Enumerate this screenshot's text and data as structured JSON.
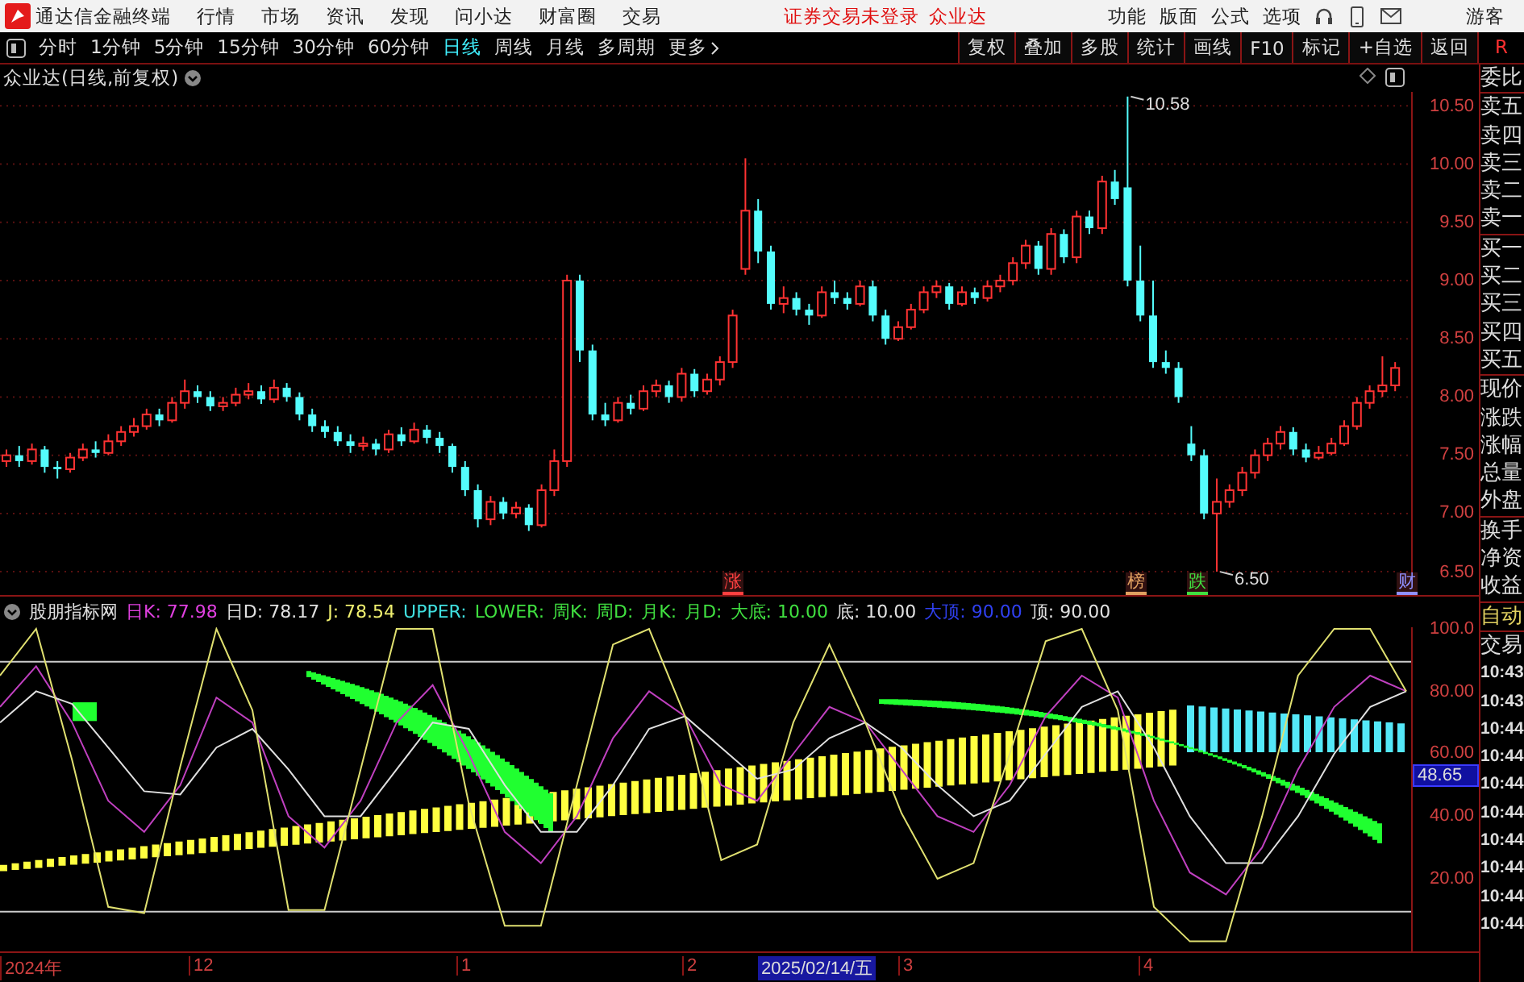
{
  "topbar": {
    "app_title": "通达信金融终端",
    "menu": [
      "行情",
      "市场",
      "资讯",
      "发现",
      "问小达",
      "财富圈",
      "交易"
    ],
    "notice": "证券交易未登录",
    "stock_name": "众业达",
    "right_menu": [
      "功能",
      "版面",
      "公式",
      "选项"
    ],
    "user": "游客"
  },
  "toolbar": {
    "periods": [
      {
        "label": "分时",
        "selected": false
      },
      {
        "label": "1分钟",
        "selected": false
      },
      {
        "label": "5分钟",
        "selected": false
      },
      {
        "label": "15分钟",
        "selected": false
      },
      {
        "label": "30分钟",
        "selected": false
      },
      {
        "label": "60分钟",
        "selected": false
      },
      {
        "label": "日线",
        "selected": true
      },
      {
        "label": "周线",
        "selected": false
      },
      {
        "label": "月线",
        "selected": false
      },
      {
        "label": "多周期",
        "selected": false
      },
      {
        "label": "更多",
        "selected": false
      }
    ],
    "actions": [
      "复权",
      "叠加",
      "多股",
      "统计",
      "画线",
      "F10",
      "标记",
      "+自选",
      "返回"
    ],
    "badge": "R"
  },
  "price_pane": {
    "title": "众业达(日线,前复权)",
    "chart_data": {
      "type": "candlestick",
      "grid": true,
      "ylim": [
        6.3,
        10.62
      ],
      "yticks": [
        {
          "value": 10.5,
          "label": "10.50"
        },
        {
          "value": 10,
          "label": "10.00"
        },
        {
          "value": 9.5,
          "label": "9.50"
        },
        {
          "value": 9,
          "label": "9.00"
        },
        {
          "value": 8.5,
          "label": "8.50"
        },
        {
          "value": 8,
          "label": "8.00"
        },
        {
          "value": 7.5,
          "label": "7.50"
        },
        {
          "value": 7,
          "label": "7.00"
        },
        {
          "value": 6.5,
          "label": "6.50"
        }
      ],
      "ohlc": [
        [
          7.45,
          7.55,
          7.4,
          7.5
        ],
        [
          7.5,
          7.58,
          7.4,
          7.45
        ],
        [
          7.45,
          7.6,
          7.42,
          7.55
        ],
        [
          7.55,
          7.58,
          7.35,
          7.4
        ],
        [
          7.4,
          7.45,
          7.3,
          7.38
        ],
        [
          7.38,
          7.52,
          7.35,
          7.48
        ],
        [
          7.48,
          7.6,
          7.45,
          7.55
        ],
        [
          7.55,
          7.62,
          7.48,
          7.52
        ],
        [
          7.52,
          7.68,
          7.5,
          7.62
        ],
        [
          7.62,
          7.75,
          7.58,
          7.7
        ],
        [
          7.7,
          7.82,
          7.66,
          7.75
        ],
        [
          7.75,
          7.9,
          7.72,
          7.85
        ],
        [
          7.85,
          7.9,
          7.75,
          7.8
        ],
        [
          7.8,
          8.0,
          7.78,
          7.95
        ],
        [
          7.95,
          8.15,
          7.9,
          8.05
        ],
        [
          8.05,
          8.1,
          7.95,
          8.0
        ],
        [
          8.0,
          8.05,
          7.88,
          7.92
        ],
        [
          7.92,
          8.0,
          7.88,
          7.95
        ],
        [
          7.95,
          8.08,
          7.92,
          8.02
        ],
        [
          8.02,
          8.12,
          7.98,
          8.05
        ],
        [
          8.05,
          8.1,
          7.94,
          7.98
        ],
        [
          7.98,
          8.15,
          7.95,
          8.08
        ],
        [
          8.08,
          8.12,
          7.96,
          8.0
        ],
        [
          8.0,
          8.04,
          7.8,
          7.85
        ],
        [
          7.85,
          7.9,
          7.7,
          7.75
        ],
        [
          7.75,
          7.8,
          7.65,
          7.7
        ],
        [
          7.7,
          7.75,
          7.58,
          7.62
        ],
        [
          7.62,
          7.68,
          7.52,
          7.58
        ],
        [
          7.58,
          7.66,
          7.54,
          7.6
        ],
        [
          7.6,
          7.64,
          7.5,
          7.55
        ],
        [
          7.55,
          7.72,
          7.52,
          7.68
        ],
        [
          7.68,
          7.74,
          7.58,
          7.62
        ],
        [
          7.62,
          7.78,
          7.6,
          7.72
        ],
        [
          7.72,
          7.76,
          7.6,
          7.65
        ],
        [
          7.65,
          7.7,
          7.52,
          7.58
        ],
        [
          7.58,
          7.6,
          7.35,
          7.4
        ],
        [
          7.4,
          7.45,
          7.15,
          7.2
        ],
        [
          7.2,
          7.25,
          6.88,
          6.95
        ],
        [
          6.95,
          7.15,
          6.9,
          7.1
        ],
        [
          7.1,
          7.14,
          6.95,
          7.0
        ],
        [
          7.0,
          7.1,
          6.96,
          7.05
        ],
        [
          7.05,
          7.08,
          6.85,
          6.9
        ],
        [
          6.9,
          7.25,
          6.88,
          7.2
        ],
        [
          7.2,
          7.55,
          7.15,
          7.45
        ],
        [
          7.45,
          9.05,
          7.4,
          9.0
        ],
        [
          9.0,
          9.05,
          8.3,
          8.4
        ],
        [
          8.4,
          8.45,
          7.8,
          7.85
        ],
        [
          7.85,
          7.95,
          7.75,
          7.8
        ],
        [
          7.8,
          8.0,
          7.78,
          7.95
        ],
        [
          7.95,
          8.02,
          7.85,
          7.9
        ],
        [
          7.9,
          8.1,
          7.88,
          8.05
        ],
        [
          8.05,
          8.15,
          8.0,
          8.1
        ],
        [
          8.1,
          8.14,
          7.95,
          8.0
        ],
        [
          8.0,
          8.25,
          7.96,
          8.2
        ],
        [
          8.2,
          8.24,
          8.0,
          8.05
        ],
        [
          8.05,
          8.2,
          8.02,
          8.15
        ],
        [
          8.15,
          8.35,
          8.1,
          8.3
        ],
        [
          8.3,
          8.75,
          8.25,
          8.7
        ],
        [
          9.1,
          10.05,
          9.05,
          9.6
        ],
        [
          9.6,
          9.7,
          9.15,
          9.25
        ],
        [
          9.25,
          9.3,
          8.75,
          8.8
        ],
        [
          8.8,
          8.95,
          8.72,
          8.85
        ],
        [
          8.85,
          8.9,
          8.7,
          8.75
        ],
        [
          8.75,
          8.8,
          8.62,
          8.7
        ],
        [
          8.7,
          8.95,
          8.68,
          8.9
        ],
        [
          8.9,
          9.0,
          8.8,
          8.85
        ],
        [
          8.85,
          8.9,
          8.75,
          8.8
        ],
        [
          8.8,
          9.0,
          8.78,
          8.95
        ],
        [
          8.95,
          9.0,
          8.65,
          8.7
        ],
        [
          8.7,
          8.75,
          8.45,
          8.5
        ],
        [
          8.5,
          8.65,
          8.48,
          8.6
        ],
        [
          8.6,
          8.8,
          8.58,
          8.75
        ],
        [
          8.75,
          8.95,
          8.72,
          8.9
        ],
        [
          8.9,
          9.0,
          8.85,
          8.95
        ],
        [
          8.95,
          8.98,
          8.75,
          8.8
        ],
        [
          8.8,
          8.95,
          8.78,
          8.9
        ],
        [
          8.9,
          8.94,
          8.8,
          8.85
        ],
        [
          8.85,
          9.0,
          8.82,
          8.95
        ],
        [
          8.95,
          9.05,
          8.9,
          9.0
        ],
        [
          9.0,
          9.2,
          8.96,
          9.15
        ],
        [
          9.15,
          9.35,
          9.1,
          9.3
        ],
        [
          9.3,
          9.34,
          9.05,
          9.1
        ],
        [
          9.1,
          9.45,
          9.05,
          9.4
        ],
        [
          9.4,
          9.44,
          9.15,
          9.2
        ],
        [
          9.2,
          9.6,
          9.15,
          9.55
        ],
        [
          9.55,
          9.6,
          9.4,
          9.45
        ],
        [
          9.45,
          9.9,
          9.4,
          9.85
        ],
        [
          9.85,
          9.95,
          9.65,
          9.7
        ],
        [
          9.8,
          10.58,
          8.95,
          9.0
        ],
        [
          9.0,
          9.3,
          8.65,
          8.7
        ],
        [
          8.7,
          9.0,
          8.25,
          8.3
        ],
        [
          8.3,
          8.4,
          8.2,
          8.25
        ],
        [
          8.25,
          8.3,
          7.95,
          8.0
        ],
        [
          7.6,
          7.75,
          7.45,
          7.5
        ],
        [
          7.5,
          7.55,
          6.95,
          7.0
        ],
        [
          7.0,
          7.3,
          6.5,
          7.1
        ],
        [
          7.1,
          7.25,
          7.05,
          7.2
        ],
        [
          7.2,
          7.4,
          7.15,
          7.35
        ],
        [
          7.35,
          7.55,
          7.3,
          7.5
        ],
        [
          7.5,
          7.65,
          7.45,
          7.6
        ],
        [
          7.6,
          7.75,
          7.55,
          7.7
        ],
        [
          7.7,
          7.74,
          7.5,
          7.55
        ],
        [
          7.55,
          7.6,
          7.44,
          7.48
        ],
        [
          7.48,
          7.58,
          7.46,
          7.52
        ],
        [
          7.52,
          7.65,
          7.5,
          7.6
        ],
        [
          7.6,
          7.8,
          7.58,
          7.75
        ],
        [
          7.75,
          8.0,
          7.72,
          7.95
        ],
        [
          7.95,
          8.1,
          7.9,
          8.05
        ],
        [
          8.05,
          8.35,
          8.0,
          8.1
        ],
        [
          8.1,
          8.3,
          8.05,
          8.25
        ]
      ]
    },
    "annotations": [
      {
        "kind": "high",
        "text": "10.58"
      },
      {
        "kind": "low",
        "text": "6.50"
      }
    ],
    "markers": [
      {
        "text": "涨",
        "color": "#ff4040"
      },
      {
        "text": "榜",
        "color": "#e0a060"
      },
      {
        "text": "跌",
        "color": "#40e040"
      },
      {
        "text": "财",
        "color": "#9090ff"
      }
    ]
  },
  "indicator_pane": {
    "legend": [
      {
        "text": "股朋指标网",
        "color": "#e0e0e0"
      },
      {
        "text": "日K: 77.98",
        "color": "#e040e0"
      },
      {
        "text": "日D: 78.17",
        "color": "#e0e0e0"
      },
      {
        "text": "J: 78.54",
        "color": "#f0f070"
      },
      {
        "text": "UPPER:",
        "color": "#40e0e0"
      },
      {
        "text": "LOWER:",
        "color": "#40e040"
      },
      {
        "text": "周K:",
        "color": "#40e040"
      },
      {
        "text": "周D:",
        "color": "#40e040"
      },
      {
        "text": "月K:",
        "color": "#40e040"
      },
      {
        "text": "月D:",
        "color": "#40e040"
      },
      {
        "text": "大底: 10.00",
        "color": "#40e040"
      },
      {
        "text": "底: 10.00",
        "color": "#e0e0e0"
      },
      {
        "text": "大顶: 90.00",
        "color": "#3040f0"
      },
      {
        "text": "顶: 90.00",
        "color": "#e0e0e0"
      }
    ],
    "value_badge": "48.65",
    "chart_data": {
      "type": "line",
      "ylim": [
        -2.7,
        100.5
      ],
      "yticks": [
        {
          "value": 100,
          "label": "100.0"
        },
        {
          "value": 80,
          "label": "80.00"
        },
        {
          "value": 60,
          "label": "60.00"
        },
        {
          "value": 40,
          "label": "40.00"
        },
        {
          "value": 20,
          "label": "20.00"
        }
      ],
      "series": [
        {
          "color": "#c040c0",
          "values": [
            75,
            88,
            70,
            45,
            35,
            50,
            78,
            70,
            40,
            30,
            45,
            70,
            82,
            60,
            35,
            25,
            40,
            65,
            80,
            72,
            50,
            45,
            60,
            75,
            70,
            55,
            40,
            35,
            50,
            72,
            85,
            78,
            45,
            22,
            15,
            30,
            55,
            75,
            85,
            80
          ]
        },
        {
          "color": "#e0e0e0",
          "values": [
            70,
            80,
            76,
            62,
            48,
            47,
            62,
            68,
            55,
            40,
            40,
            55,
            70,
            68,
            50,
            35,
            35,
            50,
            68,
            72,
            62,
            52,
            55,
            65,
            70,
            62,
            50,
            40,
            45,
            60,
            75,
            80,
            62,
            40,
            25,
            25,
            40,
            60,
            75,
            80
          ]
        },
        {
          "color": "#e0e070",
          "values": [
            85,
            100,
            58,
            11,
            9,
            56,
            100,
            74,
            10,
            10,
            55,
            100,
            100,
            44,
            5,
            5,
            50,
            95,
            100,
            72,
            26,
            31,
            70,
            95,
            70,
            41,
            20,
            25,
            60,
            96,
            100,
            74,
            11,
            0,
            0,
            40,
            85,
            100,
            100,
            80
          ]
        }
      ]
    }
  },
  "date_axis": {
    "labels": [
      {
        "text": "2024年",
        "selected": false
      },
      {
        "text": "12",
        "selected": false
      },
      {
        "text": "1",
        "selected": false
      },
      {
        "text": "2",
        "selected": false
      },
      {
        "text": "2025/02/14/五",
        "selected": true
      },
      {
        "text": "3",
        "selected": false
      },
      {
        "text": "4",
        "selected": false
      }
    ]
  },
  "side_panel": {
    "groups": [
      {
        "kind": "quote",
        "items": [
          "委比"
        ]
      },
      {
        "kind": "quote",
        "items": [
          "卖五",
          "卖四",
          "卖三",
          "卖二",
          "卖一"
        ]
      },
      {
        "kind": "quote",
        "items": [
          "买一",
          "买二",
          "买三",
          "买四",
          "买五"
        ]
      },
      {
        "kind": "quote",
        "items": [
          "现价",
          "涨跌",
          "涨幅",
          "总量",
          "外盘"
        ]
      },
      {
        "kind": "quote",
        "items": [
          "换手",
          "净资",
          "收益"
        ]
      },
      {
        "kind": "mode",
        "items": [
          "自动"
        ]
      },
      {
        "kind": "trades",
        "items": [
          "交易",
          "10:43",
          "10:43",
          "10:44",
          "10:44",
          "10:44",
          "10:44",
          "10:44",
          "10:44",
          "10:44",
          "10:44"
        ]
      }
    ]
  }
}
